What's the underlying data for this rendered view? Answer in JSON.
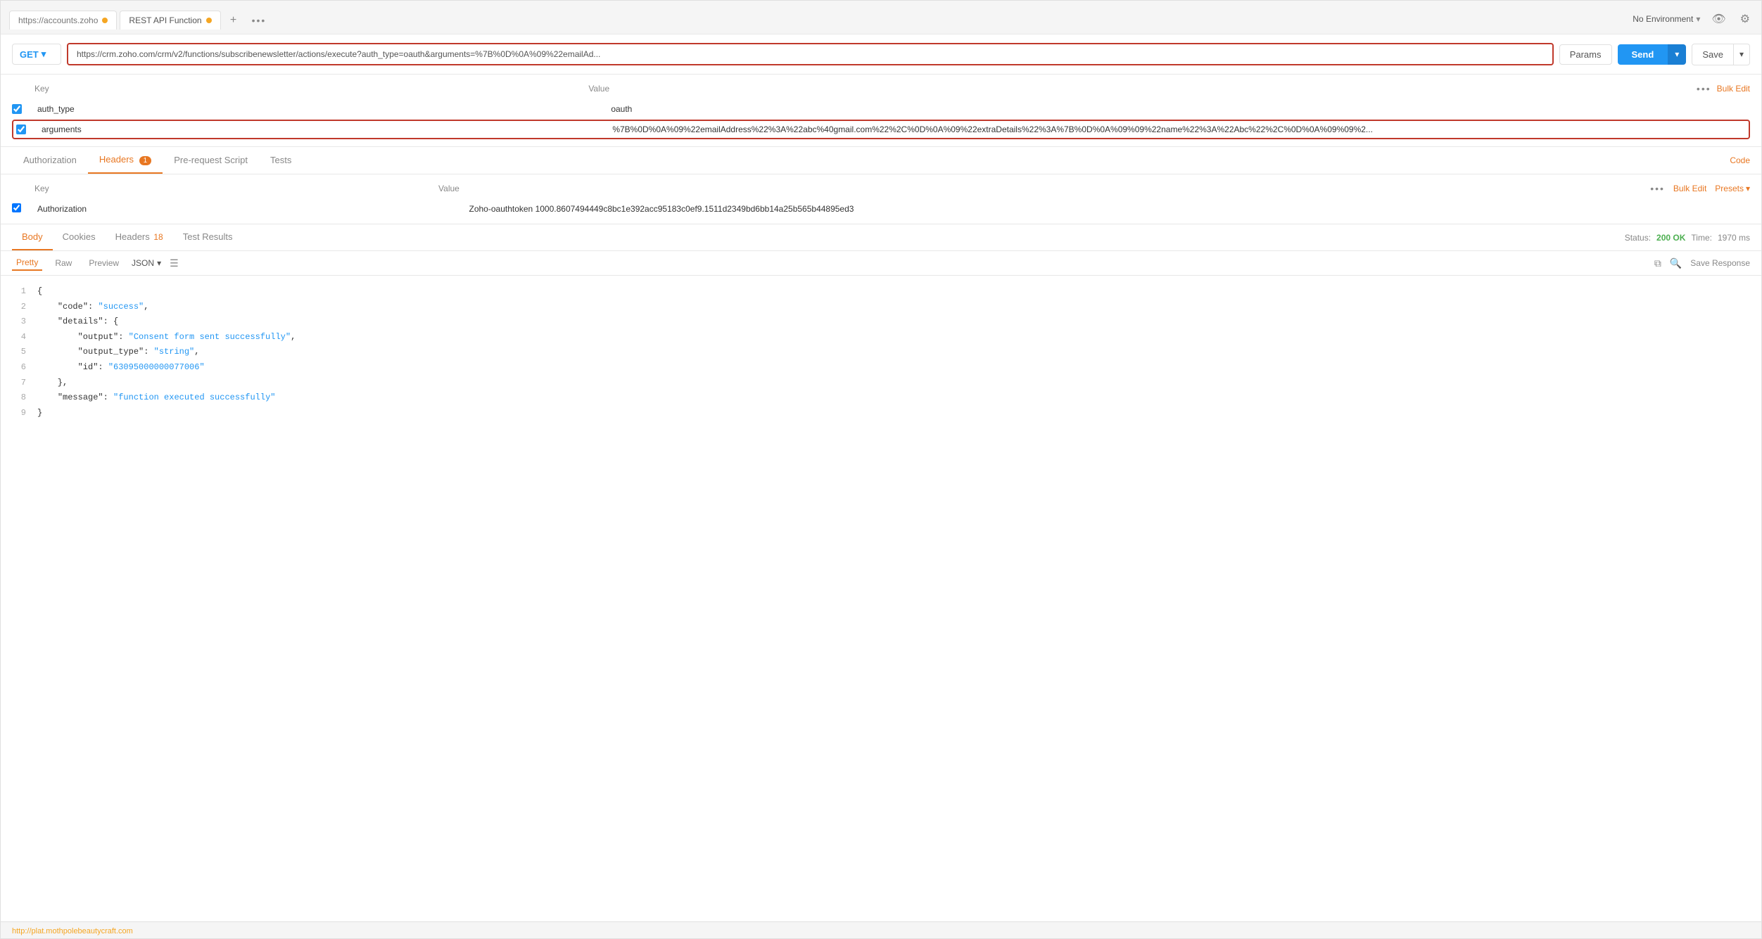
{
  "tabs": [
    {
      "id": "url-tab",
      "label": "https://accounts.zoho",
      "dot": true,
      "dotColor": "#f5a623"
    },
    {
      "id": "rest-tab",
      "label": "REST API Function",
      "dot": true,
      "dotColor": "#f5a623"
    }
  ],
  "tab_add_label": "+",
  "tab_more_label": "•••",
  "env": {
    "label": "No Environment",
    "chevron": "▾"
  },
  "request": {
    "method": "GET",
    "url": "https://crm.zoho.com/crm/v2/functions/subscribenewsletter/actions/execute?auth_type=oauth&arguments=%7B%0D%0A%09%22emailAd...",
    "params_btn": "Params",
    "send_btn": "Send",
    "save_btn": "Save"
  },
  "params": {
    "headers": [
      "Key",
      "Value"
    ],
    "bulk_edit": "Bulk Edit",
    "rows": [
      {
        "checked": true,
        "key": "auth_type",
        "value": "oauth",
        "highlighted": false
      },
      {
        "checked": true,
        "key": "arguments",
        "value": "%7B%0D%0A%09%22emailAddress%22%3A%22abc%40gmail.com%22%2C%0D%0A%09%22extraDetails%22%3A%7B%0D%0A%09%09%22name%22%3A%22Abc%22%2C%0D%0A%09%09%2...",
        "highlighted": true
      }
    ]
  },
  "request_tabs": [
    {
      "id": "authorization",
      "label": "Authorization",
      "active": false,
      "badge": null
    },
    {
      "id": "headers",
      "label": "Headers",
      "active": true,
      "badge": "1"
    },
    {
      "id": "pre-request",
      "label": "Pre-request Script",
      "active": false,
      "badge": null
    },
    {
      "id": "tests",
      "label": "Tests",
      "active": false,
      "badge": null
    }
  ],
  "code_link": "Code",
  "headers": {
    "columns": [
      "Key",
      "Value"
    ],
    "bulk_edit": "Bulk Edit",
    "presets": "Presets",
    "rows": [
      {
        "checked": true,
        "key": "Authorization",
        "value": "Zoho-oauthtoken 1000.8607494449c8bc1e392acc95183c0ef9.1511d2349bd6bb14a25b565b44895ed3"
      }
    ]
  },
  "response": {
    "tabs": [
      {
        "id": "body",
        "label": "Body",
        "active": true,
        "badge": null
      },
      {
        "id": "cookies",
        "label": "Cookies",
        "active": false,
        "badge": null
      },
      {
        "id": "headers",
        "label": "Headers",
        "active": false,
        "badge": "18"
      },
      {
        "id": "test-results",
        "label": "Test Results",
        "active": false,
        "badge": null
      }
    ],
    "status_label": "Status:",
    "status_value": "200 OK",
    "time_label": "Time:",
    "time_value": "1970 ms",
    "format_tabs": [
      "Pretty",
      "Raw",
      "Preview"
    ],
    "active_format": "Pretty",
    "format_type": "JSON",
    "save_response": "Save Response",
    "code_lines": [
      {
        "num": "1",
        "content": "{",
        "type": "bracket"
      },
      {
        "num": "2",
        "content": "    \"code\": \"success\",",
        "type": "mixed"
      },
      {
        "num": "3",
        "content": "    \"details\": {",
        "type": "mixed"
      },
      {
        "num": "4",
        "content": "        \"output\": \"Consent form sent successfully\",",
        "type": "mixed"
      },
      {
        "num": "5",
        "content": "        \"output_type\": \"string\",",
        "type": "mixed"
      },
      {
        "num": "6",
        "content": "        \"id\": \"63095000000077006\"",
        "type": "mixed"
      },
      {
        "num": "7",
        "content": "    },",
        "type": "bracket"
      },
      {
        "num": "8",
        "content": "    \"message\": \"function executed successfully\"",
        "type": "mixed"
      },
      {
        "num": "9",
        "content": "}",
        "type": "bracket"
      }
    ]
  },
  "bottom_url": "http://plat.mothpolebeautycraft.com"
}
